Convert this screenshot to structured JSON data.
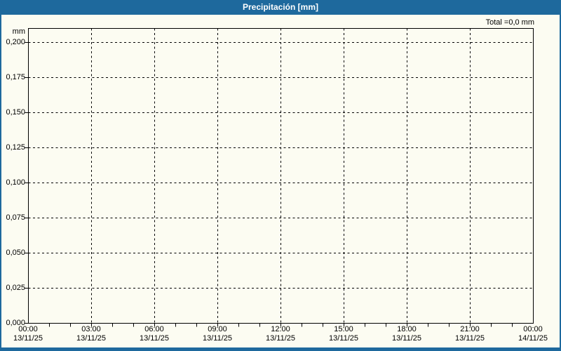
{
  "header": {
    "title": "Precipitación [mm]",
    "total_label": "Total =0,0 mm"
  },
  "colors": {
    "header_bg": "#1E699D",
    "content_bg": "#FCFCF2",
    "grid": "#000000",
    "title_text": "#FFFFFF",
    "label_text": "#000000"
  },
  "chart_data": {
    "type": "line",
    "title": "Precipitación [mm]",
    "total_annotation": "Total =0,0 mm",
    "total_value_mm": 0.0,
    "xlabel": "",
    "ylabel": "mm",
    "grid": true,
    "grid_style": "dashed",
    "ylim": [
      0,
      0.21
    ],
    "xlim_hours": [
      0,
      24
    ],
    "y_ticks": [
      {
        "value": 0.0,
        "label": "0,000"
      },
      {
        "value": 0.025,
        "label": "0,025"
      },
      {
        "value": 0.05,
        "label": "0,050"
      },
      {
        "value": 0.075,
        "label": "0,075"
      },
      {
        "value": 0.1,
        "label": "0,100"
      },
      {
        "value": 0.125,
        "label": "0,125"
      },
      {
        "value": 0.15,
        "label": "0,150"
      },
      {
        "value": 0.175,
        "label": "0,175"
      },
      {
        "value": 0.2,
        "label": "0,200"
      }
    ],
    "x_ticks": [
      {
        "hour": 0,
        "time": "00:00",
        "date": "13/11/25"
      },
      {
        "hour": 3,
        "time": "03:00",
        "date": "13/11/25"
      },
      {
        "hour": 6,
        "time": "06:00",
        "date": "13/11/25"
      },
      {
        "hour": 9,
        "time": "09:00",
        "date": "13/11/25"
      },
      {
        "hour": 12,
        "time": "12:00",
        "date": "13/11/25"
      },
      {
        "hour": 15,
        "time": "15:00",
        "date": "13/11/25"
      },
      {
        "hour": 18,
        "time": "18:00",
        "date": "13/11/25"
      },
      {
        "hour": 21,
        "time": "21:00",
        "date": "13/11/25"
      },
      {
        "hour": 24,
        "time": "00:00",
        "date": "14/11/25"
      }
    ],
    "minor_x_tick_every_hours": 1,
    "series": [
      {
        "name": "Precipitación",
        "x_hours": [],
        "values": []
      }
    ]
  }
}
